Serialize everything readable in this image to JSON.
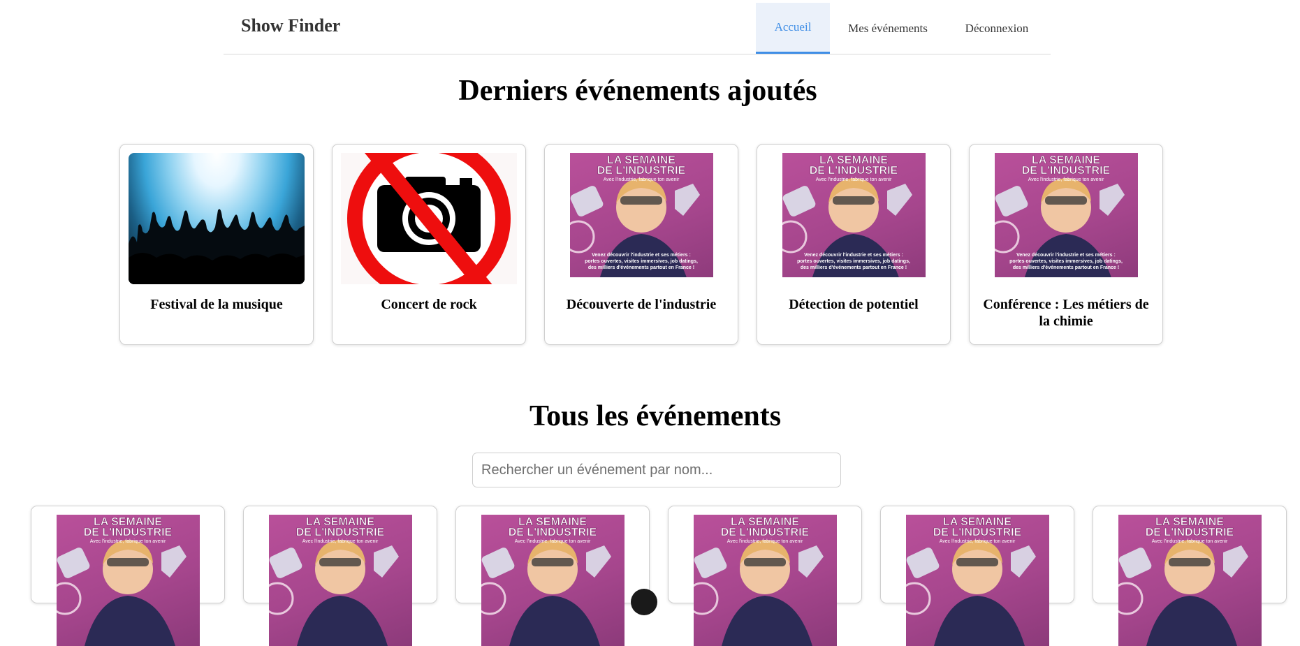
{
  "app": {
    "brand": "Show Finder"
  },
  "nav": {
    "items": [
      {
        "label": "Accueil",
        "active": true
      },
      {
        "label": "Mes événements",
        "active": false
      },
      {
        "label": "Déconnexion",
        "active": false
      }
    ],
    "accent_color": "#3f8ee6"
  },
  "latest": {
    "heading": "Derniers événements ajoutés",
    "cards": [
      {
        "title": "Festival de la musique",
        "image": "concert-crowd-image"
      },
      {
        "title": "Concert de rock",
        "image": "no-camera-sign-image"
      },
      {
        "title": "Découverte de l'industrie",
        "image": "semaine-industrie-poster"
      },
      {
        "title": "Détection de potentiel",
        "image": "semaine-industrie-poster"
      },
      {
        "title": "Conférence : Les métiers de la chimie",
        "image": "semaine-industrie-poster"
      }
    ]
  },
  "all": {
    "heading": "Tous les événements",
    "search_placeholder": "Rechercher un événement par nom..."
  },
  "poster": {
    "title_line1": "LA SEMAINE",
    "title_line2": "DE L'INDUSTRIE",
    "subtitle": "Avec l'industrie, fabrique ton avenir",
    "bottom_line1": "Venez découvrir l'industrie et ses métiers :",
    "bottom_line2": "portes ouvertes, visites immersives, job datings,",
    "bottom_line3": "des milliers d'événements partout en France !",
    "colors": {
      "background": "#b9509a",
      "text": "#ffffff"
    }
  }
}
